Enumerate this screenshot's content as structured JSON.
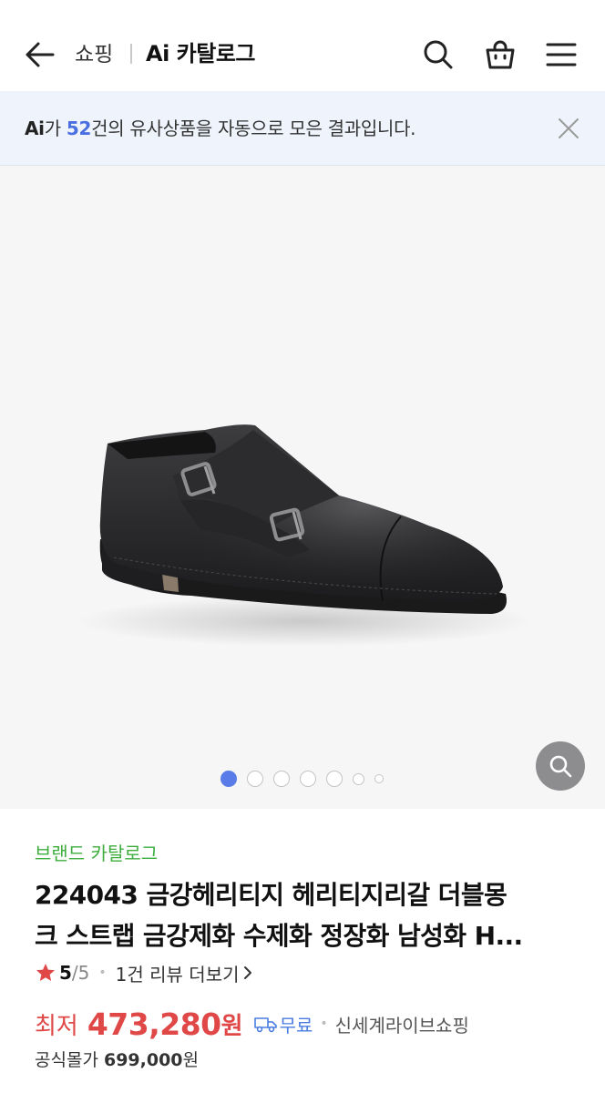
{
  "header": {
    "crumb_shopping": "쇼핑",
    "crumb_title": "Ai 카탈로그"
  },
  "banner": {
    "ai_logo": "Ai",
    "prefix": "가 ",
    "count": "52",
    "suffix": "건의 유사상품을 자동으로 모은 결과입니다."
  },
  "gallery": {
    "total_dots": 7,
    "active_index": 1
  },
  "product": {
    "brand_link": "브랜드 카탈로그",
    "title_line1": "224043 금강헤리티지 헤리티지리갈 더블몽",
    "title_line2": "크 스트랩 금강제화 수제화 정장화 남성화 H...",
    "rating_value": "5",
    "rating_max": "/5",
    "review_text": "1건 리뷰 더보기",
    "price_label": "최저",
    "price_value": "473,280",
    "price_unit": "원",
    "shipping": "무료",
    "seller": "신세계라이브쇼핑",
    "list_price_label": "공식몰가",
    "list_price_value": "699,000",
    "list_price_unit": "원"
  },
  "colors": {
    "accent_blue": "#5a7ce8",
    "price_red": "#e04848",
    "brand_green": "#3dae3d"
  },
  "icons": [
    "back-arrow-icon",
    "search-icon",
    "shopping-bag-icon",
    "menu-icon",
    "close-icon",
    "zoom-search-icon",
    "star-icon",
    "chevron-right-icon",
    "truck-icon"
  ]
}
